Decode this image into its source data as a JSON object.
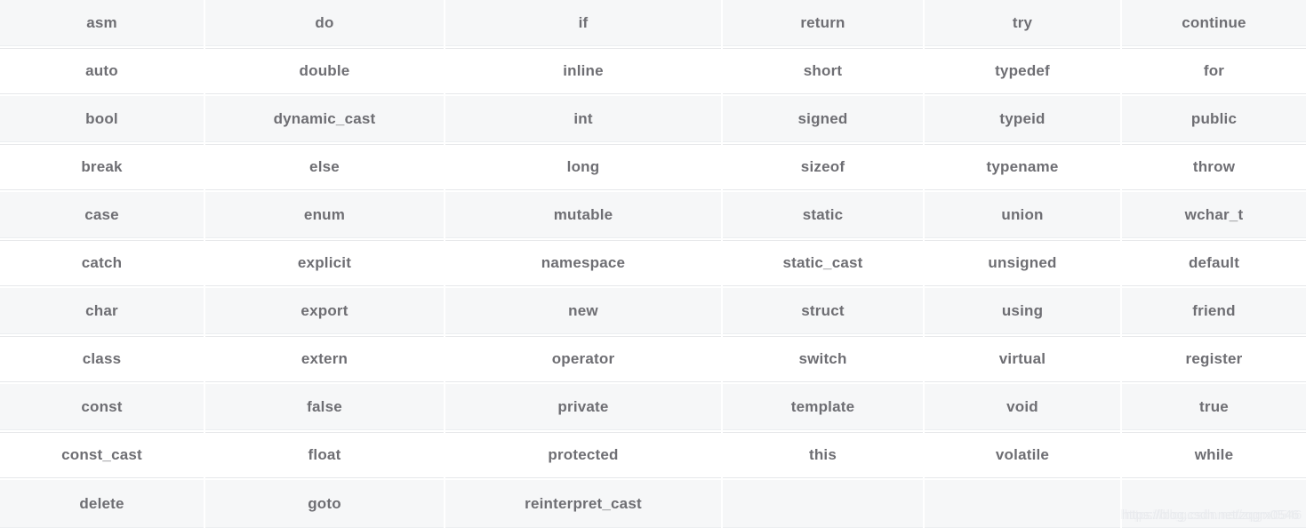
{
  "table": {
    "name": "cpp-keywords-table",
    "columns": 6,
    "rows_count": 11,
    "rows": [
      [
        "asm",
        "do",
        "if",
        "return",
        "try",
        "continue"
      ],
      [
        "auto",
        "double",
        "inline",
        "short",
        "typedef",
        "for"
      ],
      [
        "bool",
        "dynamic_cast",
        "int",
        "signed",
        "typeid",
        "public"
      ],
      [
        "break",
        "else",
        "long",
        "sizeof",
        "typename",
        "throw"
      ],
      [
        "case",
        "enum",
        "mutable",
        "static",
        "union",
        "wchar_t"
      ],
      [
        "catch",
        "explicit",
        "namespace",
        "static_cast",
        "unsigned",
        "default"
      ],
      [
        "char",
        "export",
        "new",
        "struct",
        "using",
        "friend"
      ],
      [
        "class",
        "extern",
        "operator",
        "switch",
        "virtual",
        "register"
      ],
      [
        "const",
        "false",
        "private",
        "template",
        "void",
        "true"
      ],
      [
        "const_cast",
        "float",
        "protected",
        "this",
        "volatile",
        "while"
      ],
      [
        "delete",
        "goto",
        "reinterpret_cast",
        "",
        "",
        ""
      ]
    ]
  },
  "watermark": {
    "text": "https://blog.csdn.net/zqgrx0546"
  },
  "colors": {
    "text": "#6e6e73",
    "row_odd_bg": "#f6f7f8",
    "row_even_bg": "#ffffff",
    "border": "#e6e8ea",
    "watermark": "#e9ebee"
  }
}
